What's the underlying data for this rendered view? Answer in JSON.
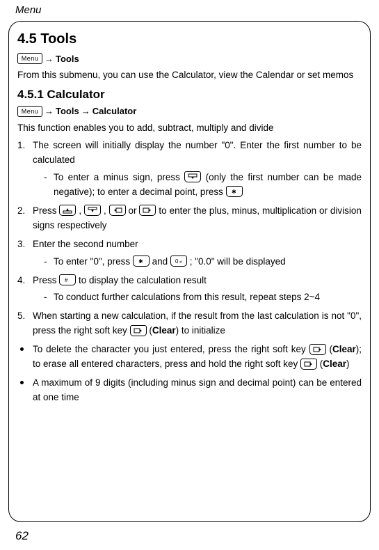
{
  "header": "Menu",
  "pageNumber": "62",
  "section": {
    "title": "4.5 Tools",
    "nav1": {
      "menu": "Menu",
      "path": "Tools"
    },
    "intro": "From this submenu, you can use the Calculator, view the Calendar or set memos",
    "sub": {
      "title": "4.5.1 Calculator",
      "nav2": {
        "menu": "Menu",
        "path1": "Tools",
        "path2": "Calculator"
      },
      "desc": "This function enables you to add, subtract, multiply and divide",
      "steps": {
        "s1": "The screen will initially display the number \"0\". Enter the first number to be calculated",
        "s1a_pre": "To enter a minus sign, press ",
        "s1a_mid": " (only the first number can be made negative); to enter a decimal point, press ",
        "s2_pre": "Press ",
        "s2_mid1": ", ",
        "s2_mid2": ", ",
        "s2_mid3": " or ",
        "s2_post": " to enter the plus, minus, multiplication or division signs respectively",
        "s3": "Enter the second number",
        "s3a_pre": "To enter \"0\", press ",
        "s3a_mid": " and ",
        "s3a_post": "; \"0.0\" will be displayed",
        "s4_pre": "Press ",
        "s4_post": " to display the calculation result",
        "s4a": "To conduct further calculations from this result, repeat steps 2~4",
        "s5_pre": "When starting a new calculation, if the result from the last calculation is not \"0\", press the right soft key ",
        "s5_mid": " (",
        "s5_clear": "Clear",
        "s5_post": ") to initialize"
      },
      "bullets": {
        "b1_pre": "To delete the character you just entered, press the right soft key ",
        "b1_mid1": " (",
        "b1_clear1": "Clear",
        "b1_mid2": "); to erase all entered characters, press and hold the right soft key ",
        "b1_mid3": " (",
        "b1_clear2": "Clear",
        "b1_post": ")",
        "b2": "A maximum of 9 digits (including minus sign and decimal point) can be entered at one time"
      }
    }
  }
}
